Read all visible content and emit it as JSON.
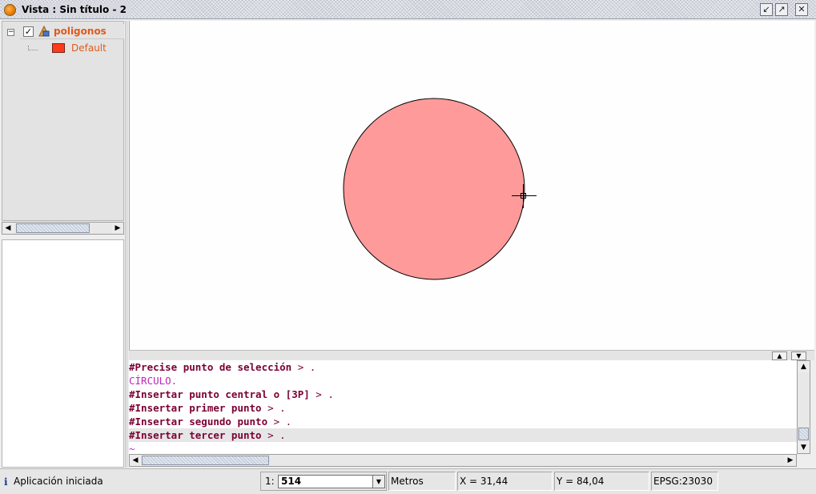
{
  "window": {
    "title": "Vista : Sin título - 2",
    "icon": "gvsig-app-icon",
    "buttons": [
      "minimize-icon",
      "maximize-icon",
      "close-icon"
    ]
  },
  "toc": {
    "layer": {
      "name": "poligonos",
      "checked": true
    },
    "legend": {
      "label": "Default",
      "color": "#ff3b1d"
    }
  },
  "map": {
    "circle": {
      "fill": "#ff9a9a",
      "stroke": "#000000"
    }
  },
  "console": {
    "lines": [
      {
        "prefix": "#Precise punto de selección",
        "suffix": " > .",
        "style": "cmd"
      },
      {
        "prefix": "CÍRCULO.",
        "suffix": "",
        "style": "magenta"
      },
      {
        "prefix": "#Insertar punto central o [3P]",
        "suffix": " > .",
        "style": "cmd"
      },
      {
        "prefix": "#Insertar primer punto",
        "suffix": " > .",
        "style": "cmd"
      },
      {
        "prefix": "#Insertar segundo punto",
        "suffix": " > .",
        "style": "cmd"
      },
      {
        "prefix": "#Insertar tercer punto",
        "suffix": " > .",
        "style": "cmd"
      },
      {
        "prefix": "~",
        "suffix": "",
        "style": "magenta"
      }
    ]
  },
  "status": {
    "message": "Aplicación iniciada",
    "scale_prefix": "1:",
    "scale_value": "514",
    "units": "Metros",
    "x": "X = 31,44",
    "y": "Y = 84,04",
    "crs": "EPSG:23030"
  }
}
